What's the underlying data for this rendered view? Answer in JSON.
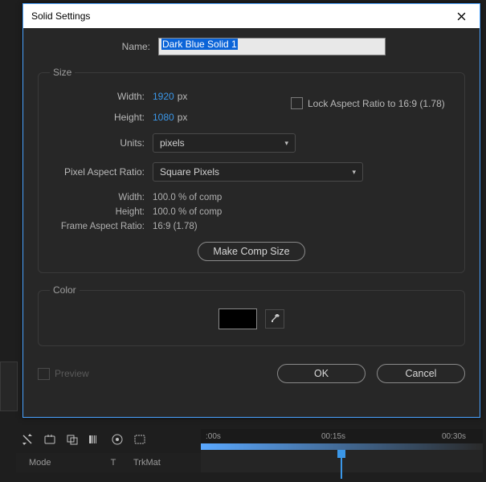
{
  "dialog": {
    "title": "Solid Settings",
    "name_label": "Name:",
    "name_value": "Dark Blue Solid 1",
    "size": {
      "legend": "Size",
      "width_label": "Width:",
      "width_value": "1920",
      "height_label": "Height:",
      "height_value": "1080",
      "px_unit": "px",
      "units_label": "Units:",
      "units_value": "pixels",
      "par_label": "Pixel Aspect Ratio:",
      "par_value": "Square Pixels",
      "lock_label": "Lock Aspect Ratio to 16:9 (1.78)",
      "ro_width_label": "Width:",
      "ro_width_value": "100.0 % of comp",
      "ro_height_label": "Height:",
      "ro_height_value": "100.0 % of comp",
      "ro_far_label": "Frame Aspect Ratio:",
      "ro_far_value": "16:9 (1.78)",
      "make_comp_label": "Make Comp Size"
    },
    "color": {
      "legend": "Color",
      "swatch_hex": "#000000"
    },
    "preview_label": "Preview",
    "ok_label": "OK",
    "cancel_label": "Cancel"
  },
  "timeline": {
    "cols": {
      "mode": "Mode",
      "t": "T",
      "trkmat": "TrkMat"
    },
    "ticks": [
      ":00s",
      "00:15s",
      "00:30s"
    ]
  }
}
